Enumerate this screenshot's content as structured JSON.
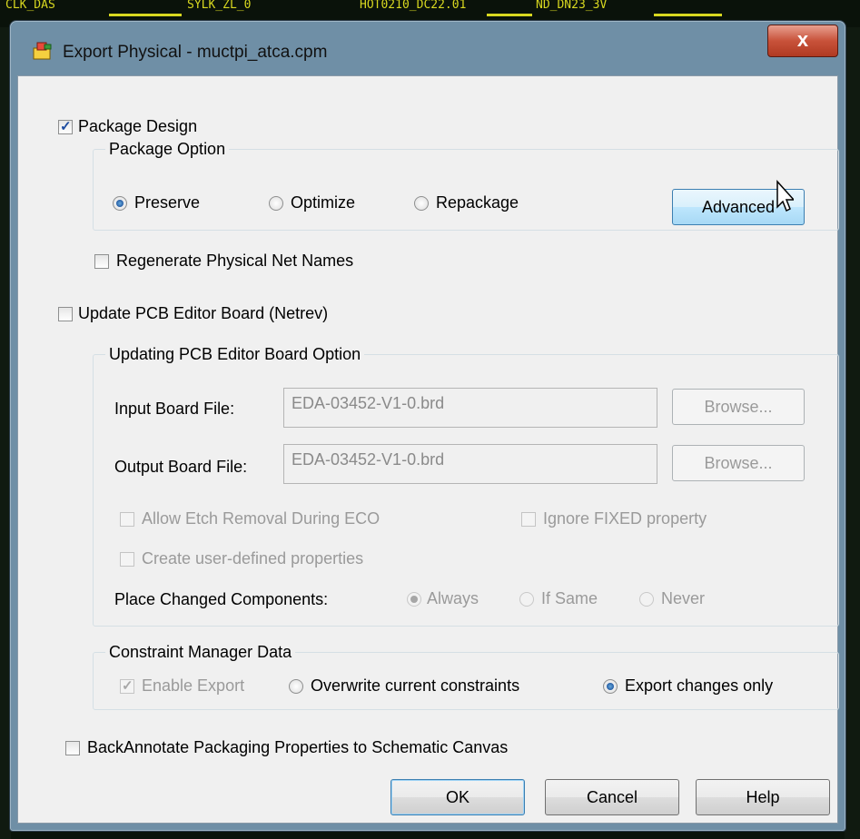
{
  "window": {
    "title": "Export Physical - muctpi_atca.cpm",
    "close_label": "x"
  },
  "background": {
    "texts": [
      "CLK_DAS",
      "SYLK_ZL_0",
      "HOT0210_DC22.01",
      "ND_DN23_3V"
    ]
  },
  "package_design": {
    "label": "Package Design",
    "checked": true
  },
  "package_option": {
    "legend": "Package Option",
    "options": [
      "Preserve",
      "Optimize",
      "Repackage"
    ],
    "selected": "Preserve",
    "advanced_label": "Advanced"
  },
  "regenerate": {
    "label": "Regenerate Physical Net Names",
    "checked": false
  },
  "update_pcb": {
    "label": "Update PCB Editor Board (Netrev)",
    "checked": false
  },
  "updating_option": {
    "legend": "Updating PCB Editor Board Option",
    "input_label": "Input Board File:",
    "input_value": "EDA-03452-V1-0.brd",
    "output_label": "Output Board File:",
    "output_value": "EDA-03452-V1-0.brd",
    "browse_label": "Browse...",
    "allow_etch_label": "Allow Etch Removal During ECO",
    "ignore_fixed_label": "Ignore FIXED property",
    "create_user_label": "Create user-defined properties",
    "place_changed_label": "Place Changed Components:",
    "place_options": [
      "Always",
      "If Same",
      "Never"
    ],
    "place_selected": "Always"
  },
  "constraint": {
    "legend": "Constraint Manager Data",
    "enable_label": "Enable Export",
    "enable_checked": true,
    "options": [
      "Overwrite current constraints",
      "Export changes only"
    ],
    "selected": "Export changes only"
  },
  "backannotate": {
    "label": "BackAnnotate Packaging Properties to Schematic Canvas",
    "checked": false
  },
  "buttons": {
    "ok": "OK",
    "cancel": "Cancel",
    "help": "Help"
  },
  "colors": {
    "accent": "#3c7fb1",
    "title_bar": "#6f8fa6",
    "close": "#c8523a"
  }
}
